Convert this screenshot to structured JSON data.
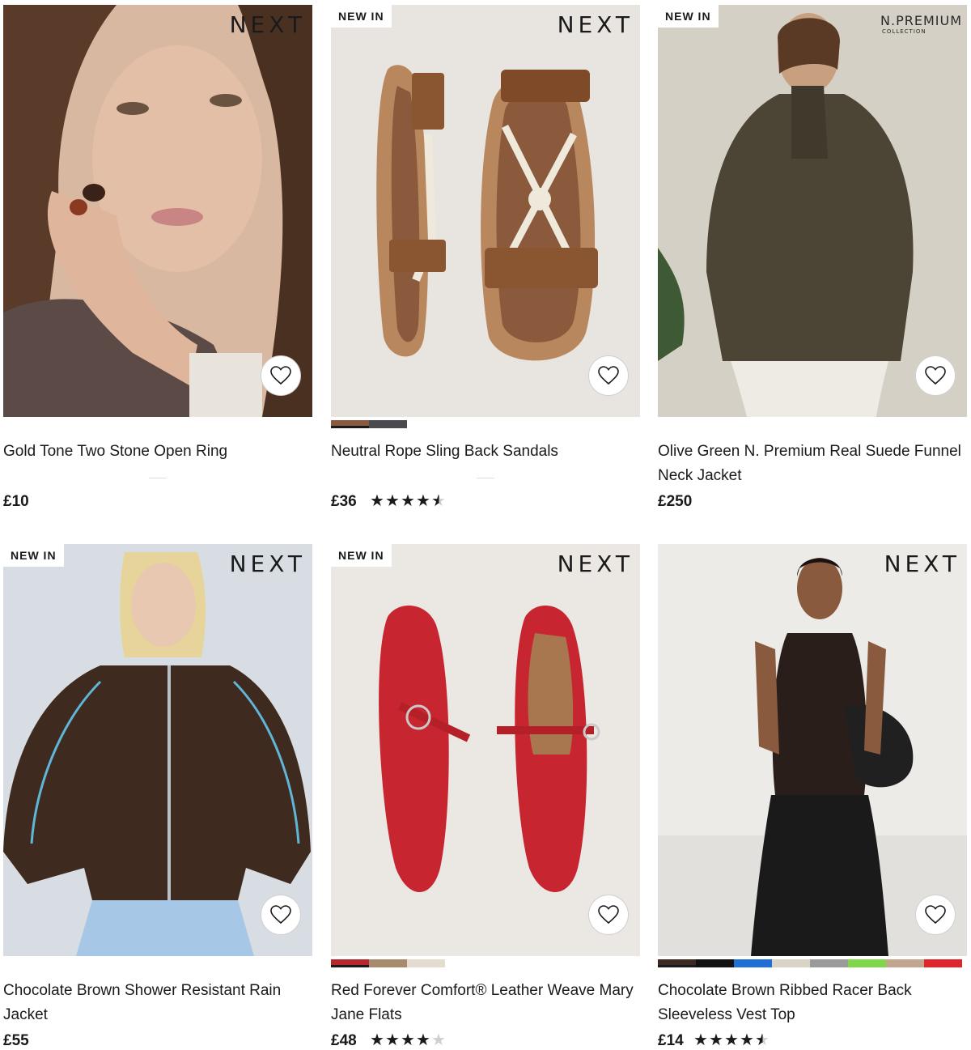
{
  "products": [
    {
      "title": "Gold Tone Two Stone Open Ring",
      "price": "£10",
      "brand": "NEXT",
      "badge": "",
      "rating": null,
      "swatches": []
    },
    {
      "title": "Neutral Rope Sling Back Sandals",
      "price": "£36",
      "brand": "NEXT",
      "badge": "NEW IN",
      "rating": 4.5,
      "swatches": [
        "#8a5a3e",
        "#4b4a4f"
      ]
    },
    {
      "title": "Olive Green N. Premium Real Suede Funnel Neck Jacket",
      "price": "£250",
      "brand": "N.PREMIUM",
      "brand_sub": "COLLECTION",
      "badge": "NEW IN",
      "rating": null,
      "swatches": []
    },
    {
      "title": "Chocolate Brown Shower Resistant Rain Jacket",
      "price": "£55",
      "brand": "NEXT",
      "badge": "NEW IN",
      "rating": null,
      "swatches": []
    },
    {
      "title": "Red Forever Comfort® Leather Weave Mary Jane Flats",
      "price": "£48",
      "brand": "NEXT",
      "badge": "NEW IN",
      "rating": 4.0,
      "swatches": [
        "#b8262d",
        "#a88a6e",
        "#e3dccf"
      ]
    },
    {
      "title": "Chocolate Brown Ribbed Racer Back Sleeveless Vest Top",
      "price": "£14",
      "brand": "NEXT",
      "badge": "",
      "rating": 4.5,
      "swatches": [
        "#3a2a22",
        "#111111",
        "#1f6fd6",
        "#d9d4c6",
        "#9a9a9a",
        "#7fd84a",
        "#c2a58c",
        "#e0262b"
      ]
    }
  ],
  "icons": {
    "favourite": "heart-outline-icon",
    "star": "star-icon"
  }
}
